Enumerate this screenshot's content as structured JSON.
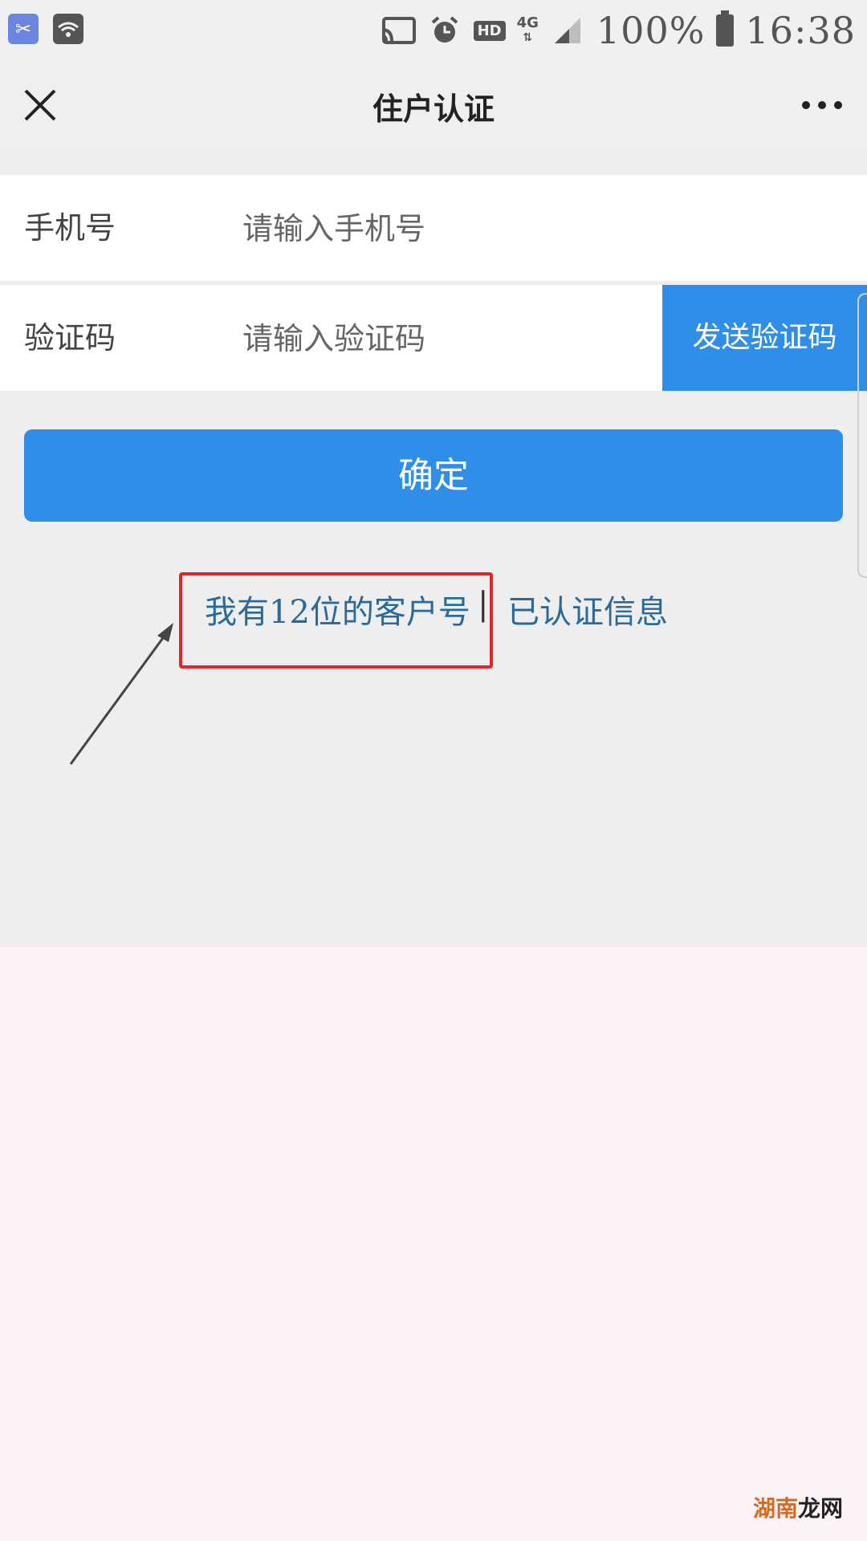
{
  "status_bar": {
    "hd_label": "HD",
    "network_label": "4G",
    "battery": "100%",
    "time": "16:38"
  },
  "nav": {
    "title": "住户认证"
  },
  "form": {
    "phone_label": "手机号",
    "phone_placeholder": "请输入手机号",
    "code_label": "验证码",
    "code_placeholder": "请输入验证码",
    "send_code_label": "发送验证码",
    "confirm_label": "确定"
  },
  "links": {
    "customer_number": "我有12位的客户号",
    "divider": "|",
    "verified_info": "已认证信息"
  },
  "watermark": {
    "part1": "湖南",
    "part2": "龙网"
  },
  "colors": {
    "primary_blue": "#2f8ee8",
    "link_blue": "#2a6a9a",
    "highlight_red": "#e0262a"
  },
  "icons": [
    "app-icon",
    "wifi-icon",
    "cast-icon",
    "alarm-icon",
    "signal-icon",
    "battery-icon",
    "close-icon",
    "more-icon",
    "arrow-annotation"
  ]
}
